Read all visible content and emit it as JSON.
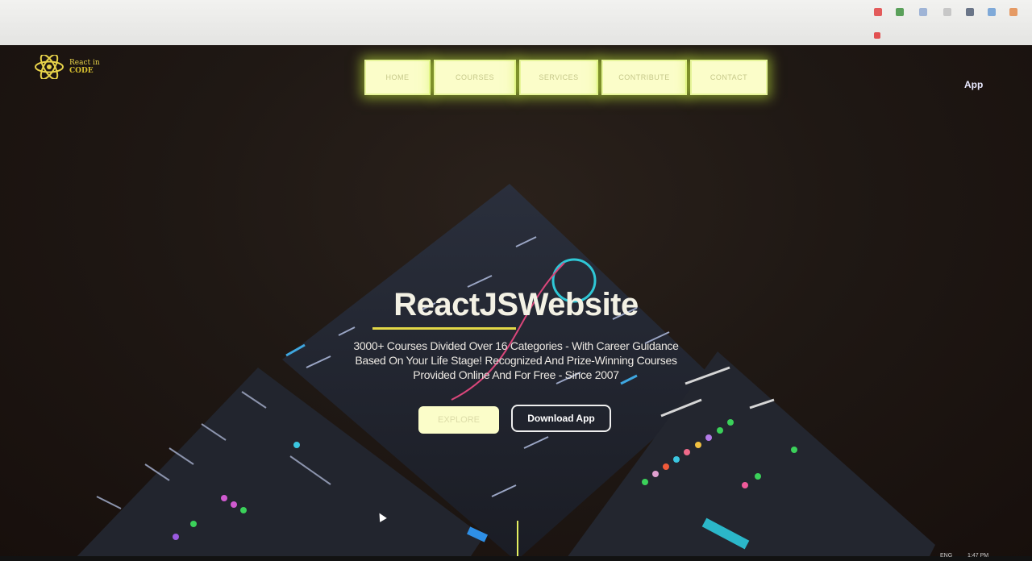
{
  "logo": {
    "icon": "react-atom-icon",
    "line1": "React in",
    "line2": "CODE"
  },
  "nav": {
    "items": [
      "HOME",
      "COURSES",
      "SERVICES",
      "CONTRIBUTE",
      "CONTACT"
    ]
  },
  "header": {
    "app_link": "App"
  },
  "hero": {
    "title": "ReactJSWebsite",
    "subtitle": "3000+ Courses Divided Over 16 Categories - With Career Guidance Based On Your Life Stage! Recognized And Prize-Winning Courses Provided Online And For Free - Since 2007",
    "primary_button": "EXPLORE",
    "secondary_button": "Download App"
  },
  "colors": {
    "accent": "#e2d847",
    "nav_bg": "#fbfdc9",
    "nav_glow": "#c8f03c",
    "page_bg": "#1e1612"
  },
  "system_tray": {
    "lang": "ENG",
    "time": "1:47 PM"
  }
}
